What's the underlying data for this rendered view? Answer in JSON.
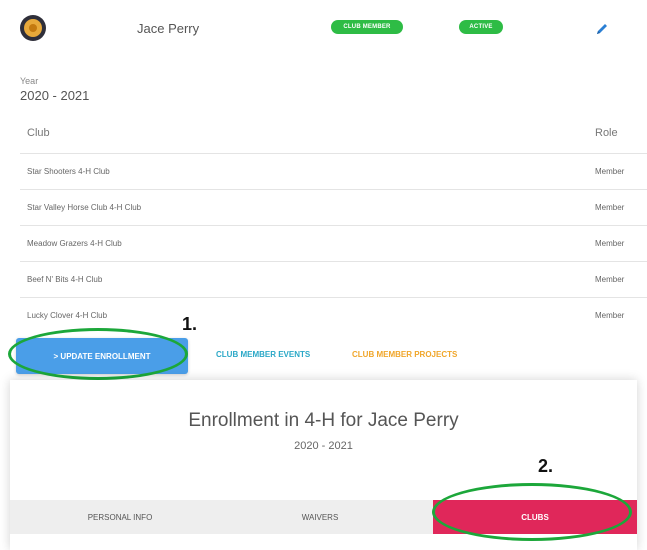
{
  "header": {
    "name": "Jace Perry",
    "badges": {
      "club_member": "CLUB MEMBER",
      "active": "ACTIVE"
    },
    "edit_icon": "pencil-icon",
    "badge_color": "#2ebc45"
  },
  "year_section": {
    "label": "Year",
    "value": "2020 - 2021"
  },
  "table": {
    "columns": [
      "Club",
      "Role"
    ],
    "rows": [
      {
        "club": "Star Shooters 4-H Club",
        "role": "Member"
      },
      {
        "club": "Star Valley Horse Club 4-H Club",
        "role": "Member"
      },
      {
        "club": "Meadow Grazers 4-H Club",
        "role": "Member"
      },
      {
        "club": "Beef N' Bits 4-H Club",
        "role": "Member"
      },
      {
        "club": "Lucky Clover 4-H Club",
        "role": "Member"
      }
    ]
  },
  "annotations": {
    "step1": "1.",
    "step2": "2.",
    "ring_color": "#1ca73a"
  },
  "actions": {
    "update_enrollment": "> UPDATE ENROLLMENT",
    "club_member_events": "CLUB MEMBER EVENTS",
    "club_member_projects": "CLUB MEMBER PROJECTS",
    "colors": {
      "update": "#4a9ee8",
      "events": "#2ba8c7",
      "projects": "#f0a62a"
    }
  },
  "enrollment_card": {
    "title": "Enrollment in 4-H for Jace Perry",
    "year": "2020 - 2021",
    "tabs": {
      "personal_info": "PERSONAL INFO",
      "waivers": "WAIVERS",
      "clubs": "CLUBS"
    },
    "active_tab_color": "#e0275a"
  }
}
